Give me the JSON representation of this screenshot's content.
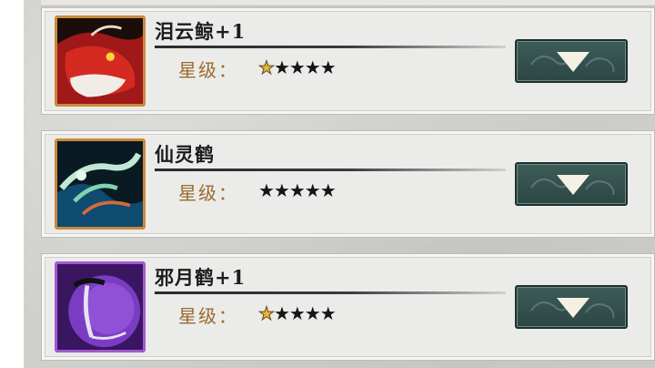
{
  "items": [
    {
      "name": "泪云鲸+1",
      "star_label": "星级：",
      "stars": "★★★★★",
      "gold_stars": 1
    },
    {
      "name": "仙灵鹤",
      "star_label": "星级：",
      "stars": "★★★★★",
      "gold_stars": 0
    },
    {
      "name": "邪月鹤+1",
      "star_label": "星级：",
      "stars": "★★★★★",
      "gold_stars": 1
    }
  ],
  "icons": {
    "expand": "chevron-down-icon",
    "star": "star-icon"
  },
  "colors": {
    "card_bg": "#ebebea",
    "button_bg": "#3d5c58",
    "star_label": "#9b6a2d",
    "gold_star": "#e6b73a",
    "portrait_border_orange": "#c98a3c",
    "portrait_border_purple": "#a05ad0"
  }
}
